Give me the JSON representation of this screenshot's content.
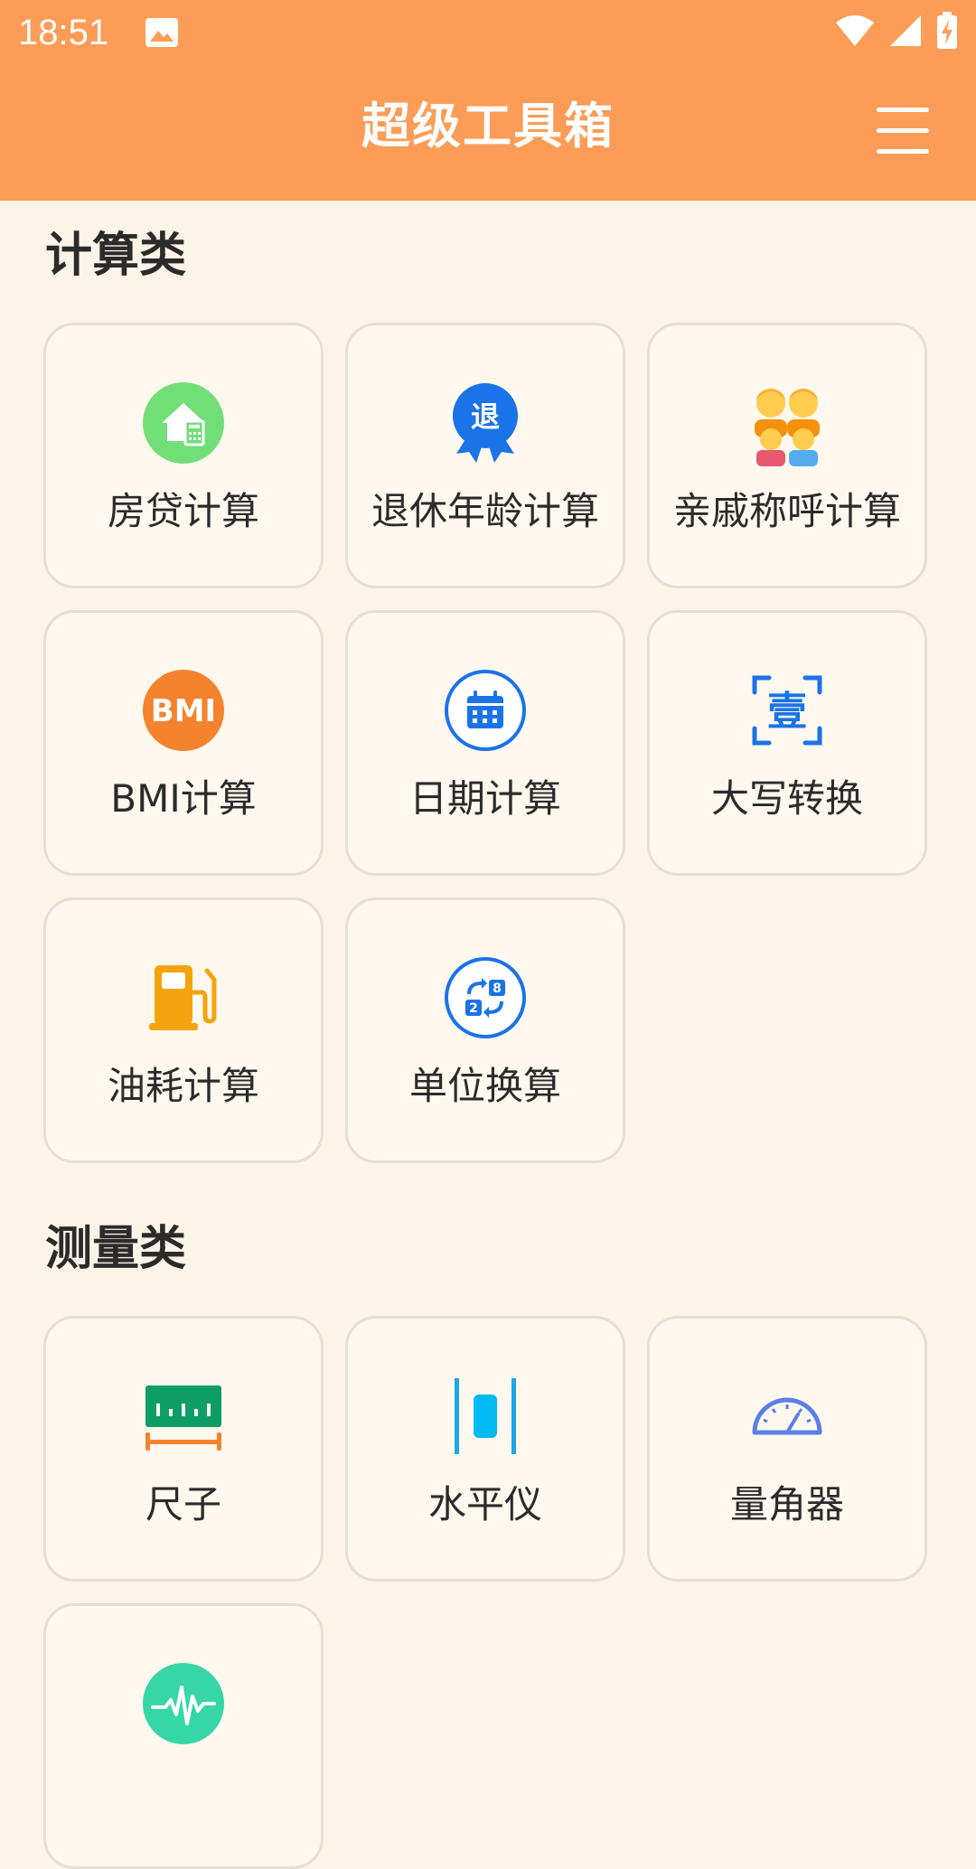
{
  "status_bar": {
    "time": "18:51",
    "background": "#FD9C56"
  },
  "app_bar": {
    "title": "超级工具箱",
    "menu_icon": "hamburger-menu-icon"
  },
  "sections": [
    {
      "title": "计算类",
      "tools": [
        {
          "label": "房贷计算",
          "icon": "house-calculator-icon"
        },
        {
          "label": "退休年龄计算",
          "icon": "retirement-badge-icon"
        },
        {
          "label": "亲戚称呼计算",
          "icon": "family-icon"
        },
        {
          "label": "BMI计算",
          "icon": "bmi-icon",
          "icon_text": "BMI"
        },
        {
          "label": "日期计算",
          "icon": "calendar-icon"
        },
        {
          "label": "大写转换",
          "icon": "uppercase-convert-icon",
          "icon_text": "壹"
        },
        {
          "label": "油耗计算",
          "icon": "fuel-pump-icon"
        },
        {
          "label": "单位换算",
          "icon": "unit-convert-icon"
        }
      ]
    },
    {
      "title": "测量类",
      "tools": [
        {
          "label": "尺子",
          "icon": "ruler-icon"
        },
        {
          "label": "水平仪",
          "icon": "level-icon"
        },
        {
          "label": "量角器",
          "icon": "protractor-icon"
        },
        {
          "label": "",
          "icon": "sound-wave-icon"
        }
      ]
    }
  ],
  "colors": {
    "accent": "#FD9C56",
    "background": "#FDF4E8",
    "card": "#FEF8EE"
  }
}
